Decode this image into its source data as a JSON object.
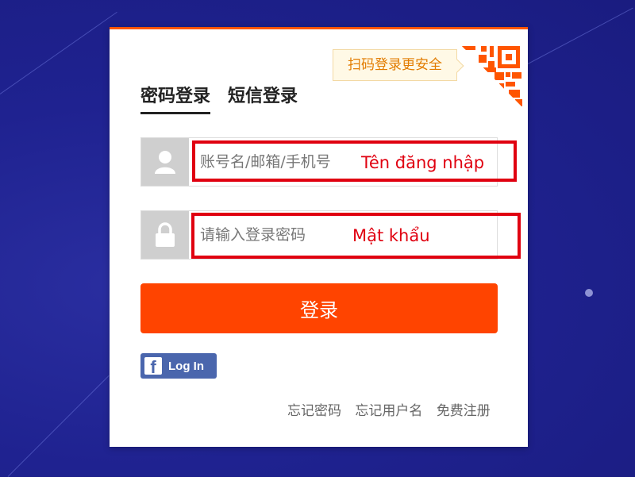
{
  "tabs": [
    {
      "label": "密码登录",
      "active": true
    },
    {
      "label": "短信登录",
      "active": false
    }
  ],
  "qr_tip": "扫码登录更安全",
  "username": {
    "placeholder": "账号名/邮箱/手机号",
    "value": "",
    "annotation": "Tên đăng nhập",
    "icon": "user-icon"
  },
  "password": {
    "placeholder": "请输入登录密码",
    "value": "",
    "annotation": "Mật khẩu",
    "icon": "lock-icon"
  },
  "login_button": "登录",
  "facebook_button": {
    "label": "Log In",
    "icon": "facebook-icon",
    "color": "#4a66ad"
  },
  "links": [
    "忘记密码",
    "忘记用户名",
    "免费注册"
  ],
  "colors": {
    "accent": "#ff4400",
    "annotation": "#e00010",
    "tip_text": "#e27c00"
  }
}
